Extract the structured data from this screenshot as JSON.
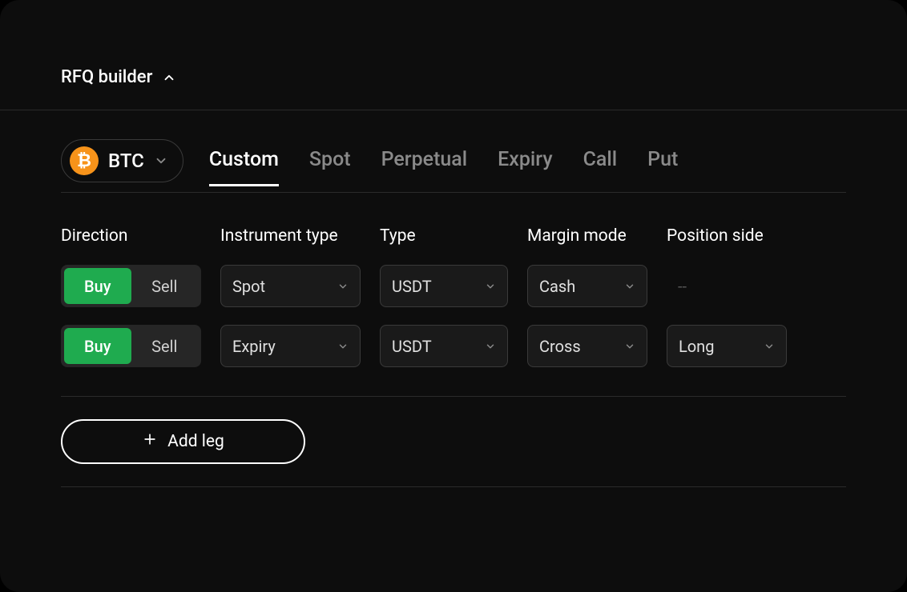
{
  "header": {
    "title": "RFQ builder"
  },
  "asset": {
    "symbol": "BTC",
    "icon_glyph": "₿"
  },
  "tabs": [
    {
      "label": "Custom",
      "active": true
    },
    {
      "label": "Spot",
      "active": false
    },
    {
      "label": "Perpetual",
      "active": false
    },
    {
      "label": "Expiry",
      "active": false
    },
    {
      "label": "Call",
      "active": false
    },
    {
      "label": "Put",
      "active": false
    }
  ],
  "columns": {
    "direction": "Direction",
    "instrument": "Instrument type",
    "type": "Type",
    "margin": "Margin mode",
    "position": "Position side"
  },
  "legs": [
    {
      "direction_buy": "Buy",
      "direction_sell": "Sell",
      "direction_active": "buy",
      "instrument": "Spot",
      "type": "USDT",
      "margin": "Cash",
      "position": "--",
      "position_empty": true
    },
    {
      "direction_buy": "Buy",
      "direction_sell": "Sell",
      "direction_active": "buy",
      "instrument": "Expiry",
      "type": "USDT",
      "margin": "Cross",
      "position": "Long",
      "position_empty": false
    }
  ],
  "add_leg": {
    "label": "Add leg"
  }
}
